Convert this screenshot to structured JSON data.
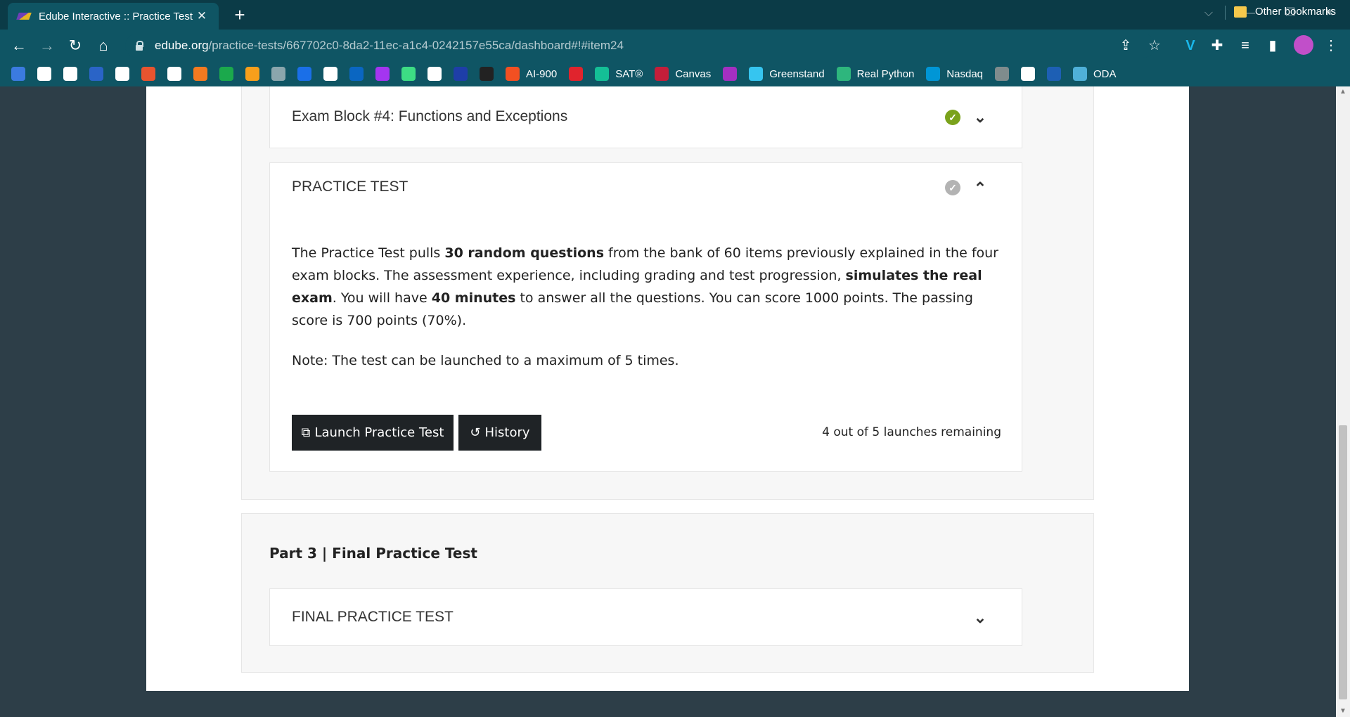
{
  "browser": {
    "tab_title": "Edube Interactive :: Practice Test |",
    "url_host": "edube.org",
    "url_path": "/practice-tests/667702c0-8da2-11ec-a1c4-0242157e55ca/dashboard#!#item24"
  },
  "bookmarks": {
    "items": [
      {
        "label": "",
        "icon": "stack-icon",
        "color": "#3b7be0"
      },
      {
        "label": "",
        "icon": "github-icon",
        "color": "#ffffff"
      },
      {
        "label": "",
        "icon": "circle-logo-icon",
        "color": "#ffffff"
      },
      {
        "label": "",
        "icon": "blue-square-icon",
        "color": "#2a64c7"
      },
      {
        "label": "",
        "icon": "python-icon",
        "color": "#ffffff"
      },
      {
        "label": "",
        "icon": "swirl-icon",
        "color": "#e8542f"
      },
      {
        "label": "",
        "icon": "lambda-icon",
        "color": "#ffffff"
      },
      {
        "label": "",
        "icon": "stripes-icon",
        "color": "#f47a20"
      },
      {
        "label": "",
        "icon": "hackerrank-icon",
        "color": "#1ba94c"
      },
      {
        "label": "",
        "icon": "leetcode-icon",
        "color": "#f89f1b"
      },
      {
        "label": "",
        "icon": "dots-icon",
        "color": "#8aa6ad"
      },
      {
        "label": "",
        "icon": "c-icon",
        "color": "#1a6fe8"
      },
      {
        "label": "",
        "icon": "edx-icon",
        "color": "#ffffff"
      },
      {
        "label": "",
        "icon": "linkedin-icon",
        "color": "#0a66c2"
      },
      {
        "label": "",
        "icon": "udemy-icon",
        "color": "#a435f0"
      },
      {
        "label": "",
        "icon": "android-icon",
        "color": "#3ddc84"
      },
      {
        "label": "",
        "icon": "code-icon",
        "color": "#ffffff"
      },
      {
        "label": "",
        "icon": "brackets-icon",
        "color": "#1e3ea8"
      },
      {
        "label": "",
        "icon": "terminal-icon",
        "color": "#222222"
      },
      {
        "label": "AI-900",
        "icon": "microsoft-icon",
        "color": "#f25022"
      },
      {
        "label": "",
        "icon": "shield-red-icon",
        "color": "#e0242d"
      },
      {
        "label": "SAT®",
        "icon": "khan-icon",
        "color": "#14bf96"
      },
      {
        "label": "Canvas",
        "icon": "harvard-icon",
        "color": "#c41e3a"
      },
      {
        "label": "",
        "icon": "ed-icon",
        "color": "#a42fc1"
      },
      {
        "label": "Greenstand",
        "icon": "slack-icon",
        "color": "#36c5f0"
      },
      {
        "label": "Real Python",
        "icon": "slack-icon",
        "color": "#2eb67d"
      },
      {
        "label": "Nasdaq",
        "icon": "chart-line-icon",
        "color": "#0096d6"
      },
      {
        "label": "",
        "icon": "aai-icon",
        "color": "#7f8c8d"
      },
      {
        "label": "",
        "icon": "mw-icon",
        "color": "#ffffff"
      },
      {
        "label": "",
        "icon": "p-icon",
        "color": "#1d5fb4"
      },
      {
        "label": "ODA",
        "icon": "dna-icon",
        "color": "#4fb0d8"
      }
    ],
    "other_label": "Other bookmarks"
  },
  "exam_block4": {
    "title": "Exam Block #4: Functions and Exceptions",
    "check_color": "#7aa21b"
  },
  "practice_test": {
    "title": "PRACTICE TEST",
    "check_color": "#b3b3b3",
    "desc_1": "The Practice Test pulls ",
    "desc_bold_1": "30 random questions",
    "desc_2": " from the bank of 60 items previously explained in the four exam blocks. The assessment experience, including grading and test progression, ",
    "desc_bold_2": "simulates the real exam",
    "desc_3": ". You will have ",
    "desc_bold_3": "40 minutes",
    "desc_4": " to answer all the questions. You can score 1000 points. The passing score is 700 points (70%).",
    "note": "Note: The test can be launched to a maximum of 5 times.",
    "launch_label": "Launch Practice Test",
    "history_label": "History",
    "remaining": "4 out of 5 launches remaining"
  },
  "part3": {
    "title": "Part 3 | Final Practice Test",
    "final_title": "FINAL PRACTICE TEST"
  }
}
